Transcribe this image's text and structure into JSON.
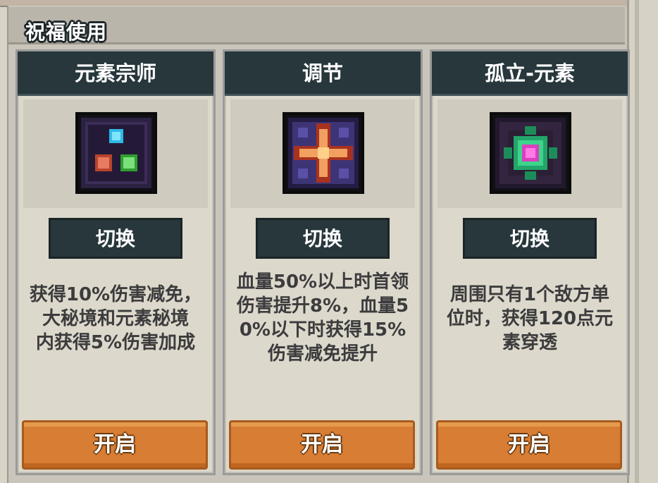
{
  "header": {
    "title": "祝福使用"
  },
  "cards": [
    {
      "name": "元素宗师",
      "switch_label": "切换",
      "desc_lines": [
        "获得10%伤害减免，",
        "大秘境和元素秘境",
        "内获得5%伤害加成"
      ],
      "enable_label": "开启",
      "icon": "elements-icon"
    },
    {
      "name": "调节",
      "switch_label": "切换",
      "desc_lines": [
        "血量50%以上时首领",
        "伤害提升8%，血量5",
        "0%以下时获得15%",
        "伤害减免提升"
      ],
      "enable_label": "开启",
      "icon": "cross-star-icon"
    },
    {
      "name": "孤立-元素",
      "switch_label": "切换",
      "desc_lines": [
        "周围只有1个敌方单",
        "位时，获得120点元",
        "素穿透"
      ],
      "enable_label": "开启",
      "icon": "isolated-gem-icon"
    }
  ],
  "colors": {
    "title_bar": "#27373c",
    "enable_button": "#d87d34",
    "card_bg": "#dcd8cb"
  }
}
